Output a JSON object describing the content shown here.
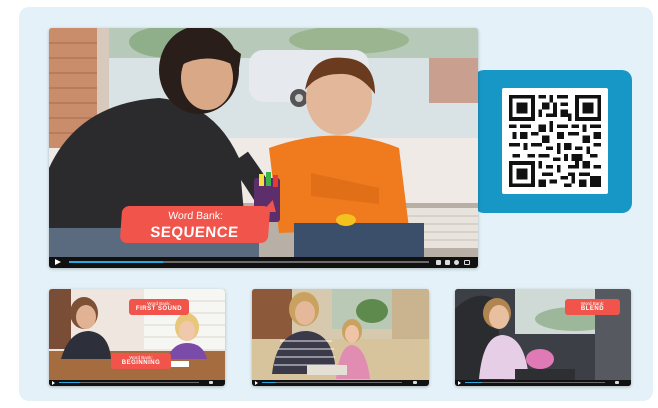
{
  "main_video": {
    "label_prefix": "Word Bank:",
    "label_word": "SEQUENCE",
    "progress": 0.26
  },
  "thumbnails": [
    {
      "labels": [
        {
          "prefix": "Word Bank:",
          "word": "FIRST SOUND"
        },
        {
          "prefix": "Word Bank:",
          "word": "BEGINNING"
        }
      ],
      "progress": 0.15
    },
    {
      "labels": [],
      "progress": 0.1
    },
    {
      "labels": [
        {
          "prefix": "Word Bank:",
          "word": "BLEND"
        }
      ],
      "progress": 0.12
    }
  ],
  "qr": {
    "icon": "qr-code-icon"
  },
  "colors": {
    "panel": "#e4f1f8",
    "qr_card": "#1797c6",
    "label": "#f0544a",
    "progress": "#2aa7de"
  }
}
